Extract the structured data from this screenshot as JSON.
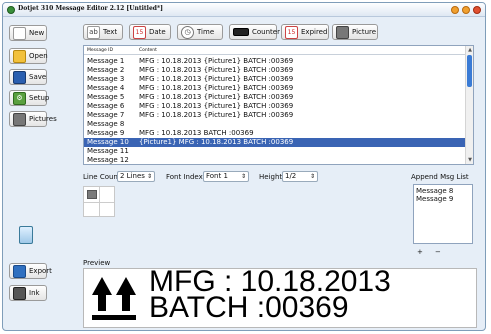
{
  "window": {
    "title": "Dotjet 310 Message Editor 2.12 [Untitled*]"
  },
  "sidebar": {
    "new_label": "New",
    "open_label": "Open",
    "save_label": "Save",
    "setup_label": "Setup",
    "pictures_label": "Pictures",
    "export_label": "Export",
    "ink_label": "Ink"
  },
  "toolbar": {
    "text_label": "Text",
    "date_label": "Date",
    "time_label": "Time",
    "counter_label": "Counter",
    "expired_label": "Expired",
    "picture_label": "Picture",
    "date_badge": "15",
    "expired_badge": "15"
  },
  "messages": {
    "col_id": "Message ID",
    "col_content": "Content",
    "rows": [
      {
        "id": "Message 1",
        "content": "MFG : 10.18.2013 {Picture1}  BATCH :00369"
      },
      {
        "id": "Message 2",
        "content": "MFG : 10.18.2013 {Picture1}  BATCH :00369"
      },
      {
        "id": "Message 3",
        "content": "MFG : 10.18.2013 {Picture1}  BATCH :00369"
      },
      {
        "id": "Message 4",
        "content": "MFG : 10.18.2013 {Picture1}  BATCH :00369"
      },
      {
        "id": "Message 5",
        "content": "MFG : 10.18.2013 {Picture1}  BATCH :00369"
      },
      {
        "id": "Message 6",
        "content": "MFG : 10.18.2013 {Picture1}  BATCH :00369"
      },
      {
        "id": "Message 7",
        "content": "MFG : 10.18.2013 {Picture1}  BATCH :00369"
      },
      {
        "id": "Message 8",
        "content": ""
      },
      {
        "id": "Message 9",
        "content": "MFG : 10.18.2013   BATCH :00369"
      },
      {
        "id": "Message 10",
        "content": "{Picture1}       MFG : 10.18.2013   BATCH :00369"
      },
      {
        "id": "Message 11",
        "content": ""
      },
      {
        "id": "Message 12",
        "content": ""
      }
    ],
    "selected_index": 9
  },
  "options": {
    "line_count_label": "Line Count",
    "line_count_value": "2 Lines",
    "font_index_label": "Font Index",
    "font_index_value": "Font 1",
    "height_label": "Height",
    "height_value": "1/2"
  },
  "append": {
    "title": "Append Msg List",
    "items": [
      "Message 8",
      "Message 9"
    ],
    "add_label": "+",
    "remove_label": "−"
  },
  "preview": {
    "label": "Preview",
    "line1": "MFG : 10.18.2013",
    "line2": "BATCH :00369"
  },
  "icons": {
    "new": "document-icon",
    "open": "folder-icon",
    "save": "floppy-icon",
    "setup": "gear-icon",
    "pictures": "picture-grid-icon",
    "export": "export-icon",
    "ink": "ink-cartridge-icon",
    "trash": "trash-icon",
    "text": "text-icon",
    "date": "calendar-icon",
    "time": "clock-icon",
    "counter": "counter-icon",
    "expired": "expired-calendar-icon",
    "picture": "picture-icon",
    "preview_symbol": "this-way-up-arrows-icon"
  },
  "colors": {
    "selection": "#3a64b4",
    "window_bg": "#e6eef7"
  }
}
